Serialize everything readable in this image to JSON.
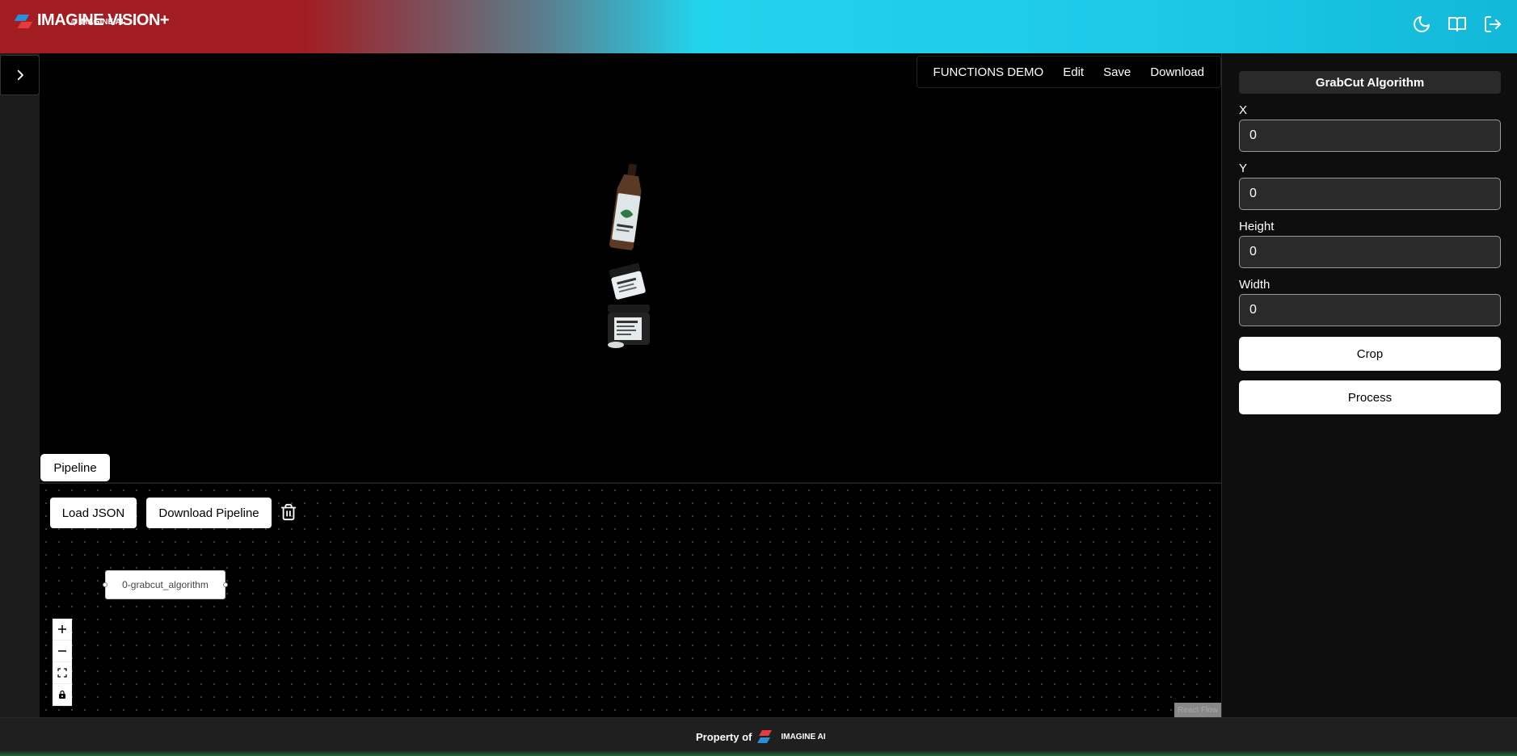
{
  "header": {
    "brand": "IMAGINE VISION+",
    "brand_by": "by",
    "brand_sub": "IMAGINE AI",
    "icons": [
      "moon-icon",
      "book-icon",
      "logout-icon"
    ]
  },
  "canvas": {
    "menu": [
      "FUNCTIONS DEMO",
      "Edit",
      "Save",
      "Download"
    ]
  },
  "pipeline": {
    "tab_label": "Pipeline",
    "load_json_label": "Load JSON",
    "download_pipeline_label": "Download Pipeline",
    "node_label": "0-grabcut_algorithm",
    "attribution": "React Flow"
  },
  "panel": {
    "title": "GrabCut Algorithm",
    "fields": [
      {
        "label": "X",
        "value": "0"
      },
      {
        "label": "Y",
        "value": "0"
      },
      {
        "label": "Height",
        "value": "0"
      },
      {
        "label": "Width",
        "value": "0"
      }
    ],
    "crop_label": "Crop",
    "process_label": "Process"
  },
  "footer": {
    "text": "Property of",
    "logo_text": "IMAGINE AI"
  },
  "colors": {
    "brand_red": "#a11d22",
    "brand_cyan": "#22d3ee",
    "footer_green": "#1d6b37"
  }
}
